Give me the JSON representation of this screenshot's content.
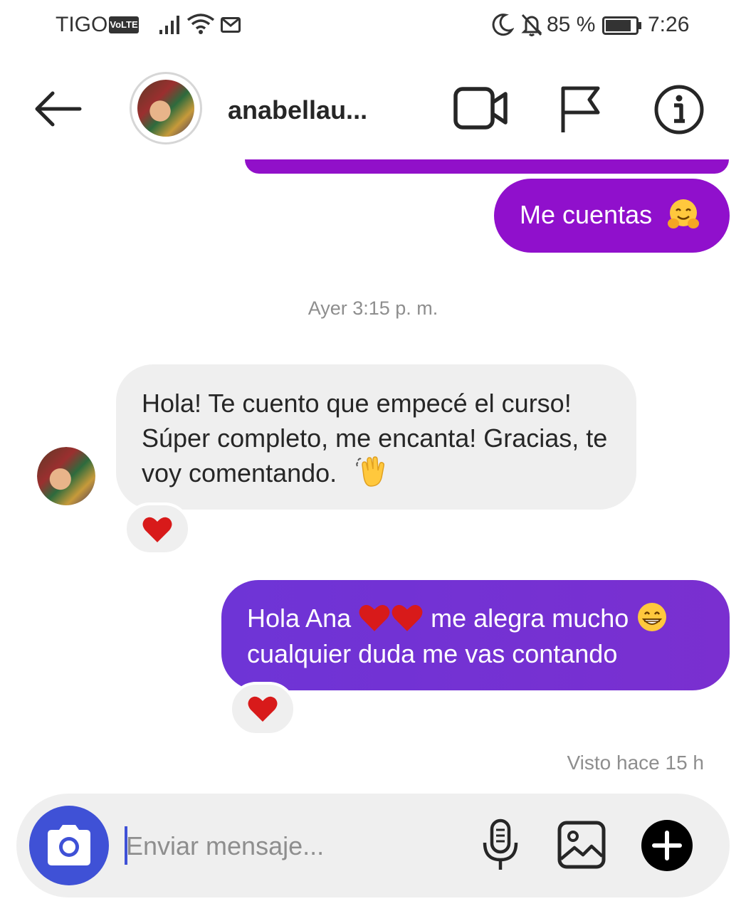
{
  "status_bar": {
    "carrier": "TIGO",
    "volte": "VoLTE",
    "battery_pct": "85 %",
    "time": "7:26",
    "battery_level": 0.85
  },
  "header": {
    "username": "anabellau..."
  },
  "messages": {
    "outgoing_1": "Me cuentas",
    "timestamp": "Ayer 3:15 p. m.",
    "incoming_1": "Hola! Te cuento que empecé el curso! Súper completo, me encanta! Gracias, te voy comentando.",
    "outgoing_2_part1": "Hola Ana",
    "outgoing_2_part2": "me alegra mucho",
    "outgoing_2_part3": "cualquier duda me vas contando",
    "seen": "Visto hace 15 h"
  },
  "composer": {
    "placeholder": "Enviar mensaje..."
  },
  "icons": {
    "back": "arrow-left-icon",
    "video": "video-camera-icon",
    "flag": "flag-icon",
    "info": "info-icon",
    "camera": "camera-icon",
    "mic": "microphone-icon",
    "gallery": "image-icon",
    "plus": "plus-icon"
  },
  "colors": {
    "outgoing_purple": "#9010cc",
    "outgoing_violet": "#7231d4",
    "camera_blue": "#3f51d6",
    "incoming_gray": "#efefef",
    "heart_red": "#d81a1a"
  }
}
